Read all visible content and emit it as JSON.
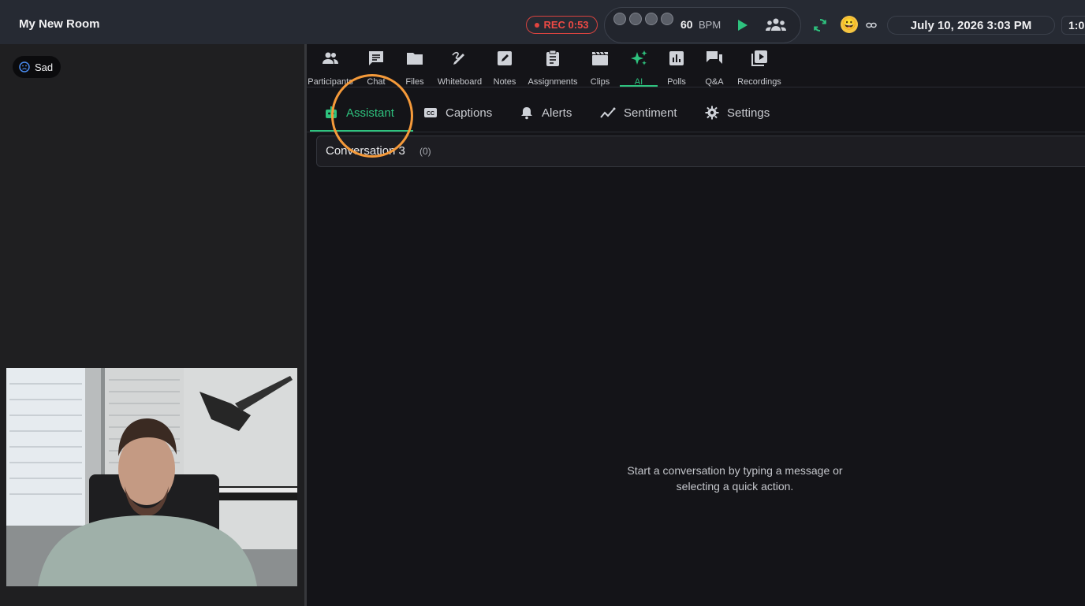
{
  "room": {
    "title": "My New Room"
  },
  "recording": {
    "label": "REC 0:53"
  },
  "metronome": {
    "beats_total": 4,
    "bpm_value": "60",
    "bpm_unit": "BPM"
  },
  "header": {
    "emoji": "😀",
    "datetime": "July 10, 2026 3:03 PM",
    "clock_partial": "1:0"
  },
  "sentiment_badge": {
    "label": "Sad"
  },
  "tools": [
    {
      "label": "Participants",
      "icon": "people-icon"
    },
    {
      "label": "Chat",
      "icon": "chat-icon"
    },
    {
      "label": "Files",
      "icon": "folder-icon"
    },
    {
      "label": "Whiteboard",
      "icon": "draw-icon"
    },
    {
      "label": "Notes",
      "icon": "note-edit-icon"
    },
    {
      "label": "Assignments",
      "icon": "clipboard-icon"
    },
    {
      "label": "Clips",
      "icon": "clapper-icon"
    },
    {
      "label": "AI",
      "icon": "sparkle-icon",
      "active": true
    },
    {
      "label": "Polls",
      "icon": "poll-icon"
    },
    {
      "label": "Q&A",
      "icon": "qa-icon"
    },
    {
      "label": "Recordings",
      "icon": "video-library-icon"
    }
  ],
  "ai_tabs": [
    {
      "label": "Assistant",
      "icon": "robot-icon",
      "active": true
    },
    {
      "label": "Captions",
      "icon": "cc-icon"
    },
    {
      "label": "Alerts",
      "icon": "bell-icon"
    },
    {
      "label": "Sentiment",
      "icon": "trend-icon"
    },
    {
      "label": "Settings",
      "icon": "gear-icon"
    }
  ],
  "conversation": {
    "title": "Conversation 3",
    "count": "(0)"
  },
  "empty_state": {
    "line1": "Start a conversation by typing a message or",
    "line2": "selecting a quick action."
  },
  "colors": {
    "accent": "#2ec27e",
    "rec": "#e2443f",
    "highlight": "#f59a3a"
  }
}
